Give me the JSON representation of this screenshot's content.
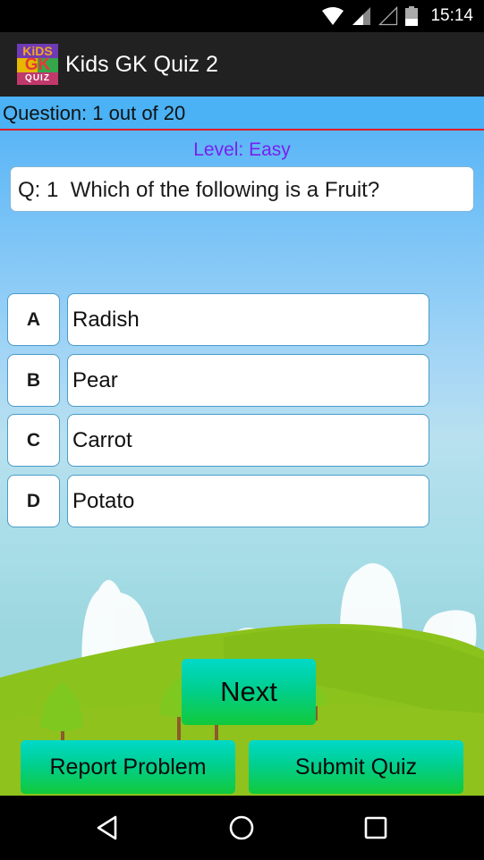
{
  "status_bar": {
    "time": "15:14",
    "icons": [
      "wifi-icon",
      "signal-icon",
      "signal-empty-icon",
      "battery-icon"
    ]
  },
  "action_bar": {
    "app_icon_text": [
      "KiDS",
      "GK",
      "QUIZ"
    ],
    "title": "Kids GK Quiz 2"
  },
  "quiz": {
    "progress_text": "Question: 1 out of 20",
    "current_question": 1,
    "total_questions": 20,
    "level_text": "Level: Easy",
    "question_text": "Q: 1  Which of the following is a Fruit?",
    "options": [
      {
        "letter": "A",
        "text": "Radish"
      },
      {
        "letter": "B",
        "text": "Pear"
      },
      {
        "letter": "C",
        "text": "Carrot"
      },
      {
        "letter": "D",
        "text": "Potato"
      }
    ]
  },
  "buttons": {
    "next": "Next",
    "report": "Report Problem",
    "submit": "Submit Quiz"
  },
  "nav_bar": {
    "icons": [
      "back-icon",
      "home-icon",
      "recent-apps-icon"
    ]
  },
  "colors": {
    "progress_bar_bg": "#4ab2f5",
    "progress_divider": "#e21b2a",
    "level_text": "#7a1ff0",
    "button_gradient_top": "#00d9c8",
    "button_gradient_bottom": "#12c93a",
    "option_border": "#4a9cc9"
  }
}
